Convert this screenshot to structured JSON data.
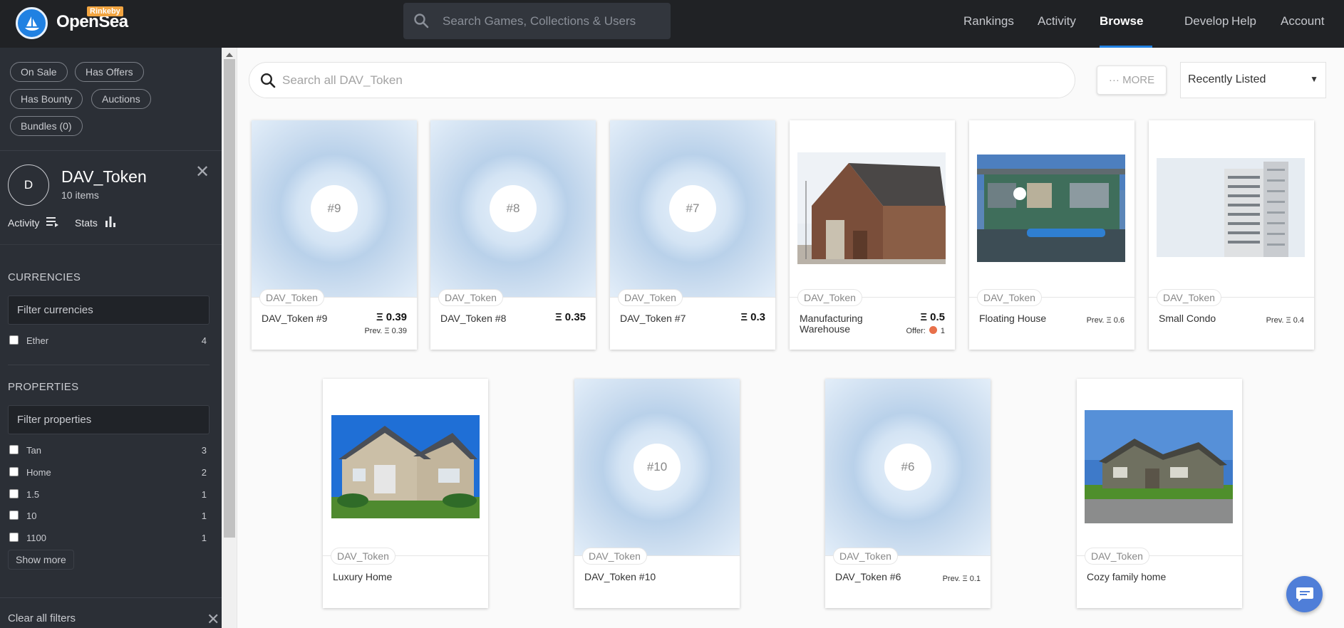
{
  "header": {
    "brand": "OpenSea",
    "network_badge": "Rinkeby",
    "search_placeholder": "Search Games, Collections & Users",
    "nav": [
      "Rankings",
      "Activity",
      "Browse",
      "Develop",
      "Help",
      "Account"
    ],
    "active_nav": "Browse"
  },
  "sidebar": {
    "status_filters": [
      "On Sale",
      "Has Offers",
      "Has Bounty",
      "Auctions",
      "Bundles (0)"
    ],
    "collection": {
      "avatar_letter": "D",
      "name": "DAV_Token",
      "count": "10 items",
      "links": [
        "Activity",
        "Stats"
      ]
    },
    "currencies": {
      "title": "CURRENCIES",
      "filter_placeholder": "Filter currencies",
      "items": [
        {
          "label": "Ether",
          "count": "4"
        }
      ]
    },
    "properties": {
      "title": "PROPERTIES",
      "filter_placeholder": "Filter properties",
      "items": [
        {
          "label": "Tan",
          "count": "3"
        },
        {
          "label": "Home",
          "count": "2"
        },
        {
          "label": "1.5",
          "count": "1"
        },
        {
          "label": "10",
          "count": "1"
        },
        {
          "label": "1100",
          "count": "1"
        }
      ],
      "show_more": "Show more"
    },
    "clear_filters": "Clear all filters"
  },
  "main": {
    "search_placeholder": "Search all DAV_Token",
    "more_button": "··· MORE",
    "sort": "Recently Listed",
    "cards": [
      {
        "tag": "DAV_Token",
        "name": "DAV_Token #9",
        "badge": "#9",
        "price": "Ξ 0.39",
        "sub": "Prev. Ξ 0.39"
      },
      {
        "tag": "DAV_Token",
        "name": "DAV_Token #8",
        "badge": "#8",
        "price": "Ξ 0.35",
        "sub": ""
      },
      {
        "tag": "DAV_Token",
        "name": "DAV_Token #7",
        "badge": "#7",
        "price": "Ξ 0.3",
        "sub": ""
      },
      {
        "tag": "DAV_Token",
        "name": "Manufacturing Warehouse",
        "image": "warehouse",
        "price": "Ξ 0.5",
        "offer_label": "Offer:",
        "offer_value": "1"
      },
      {
        "tag": "DAV_Token",
        "name": "Floating House",
        "image": "houseboat",
        "price": "",
        "sub": "Prev. Ξ 0.6"
      },
      {
        "tag": "DAV_Token",
        "name": "Small Condo",
        "image": "condo",
        "price": "",
        "sub": "Prev. Ξ 0.4"
      },
      {
        "tag": "DAV_Token",
        "name": "Luxury Home",
        "image": "luxury-home",
        "price": "",
        "sub": ""
      },
      {
        "tag": "DAV_Token",
        "name": "DAV_Token #10",
        "badge": "#10",
        "price": "",
        "sub": ""
      },
      {
        "tag": "DAV_Token",
        "name": "DAV_Token #6",
        "badge": "#6",
        "price": "",
        "sub": "Prev. Ξ 0.1"
      },
      {
        "tag": "DAV_Token",
        "name": "Cozy family home",
        "image": "family-home",
        "price": "",
        "sub": ""
      }
    ]
  },
  "icons": {
    "logo": "sailboat-logo-icon",
    "search": "search-icon",
    "activity": "list-icon",
    "stats": "bar-chart-icon",
    "close": "close-icon",
    "chat": "chat-bubble-icon"
  },
  "colors": {
    "header_bg": "#202225",
    "sidebar_bg": "#2b2f36",
    "accent": "#2081e2",
    "chat_button": "#4f7ed8"
  }
}
